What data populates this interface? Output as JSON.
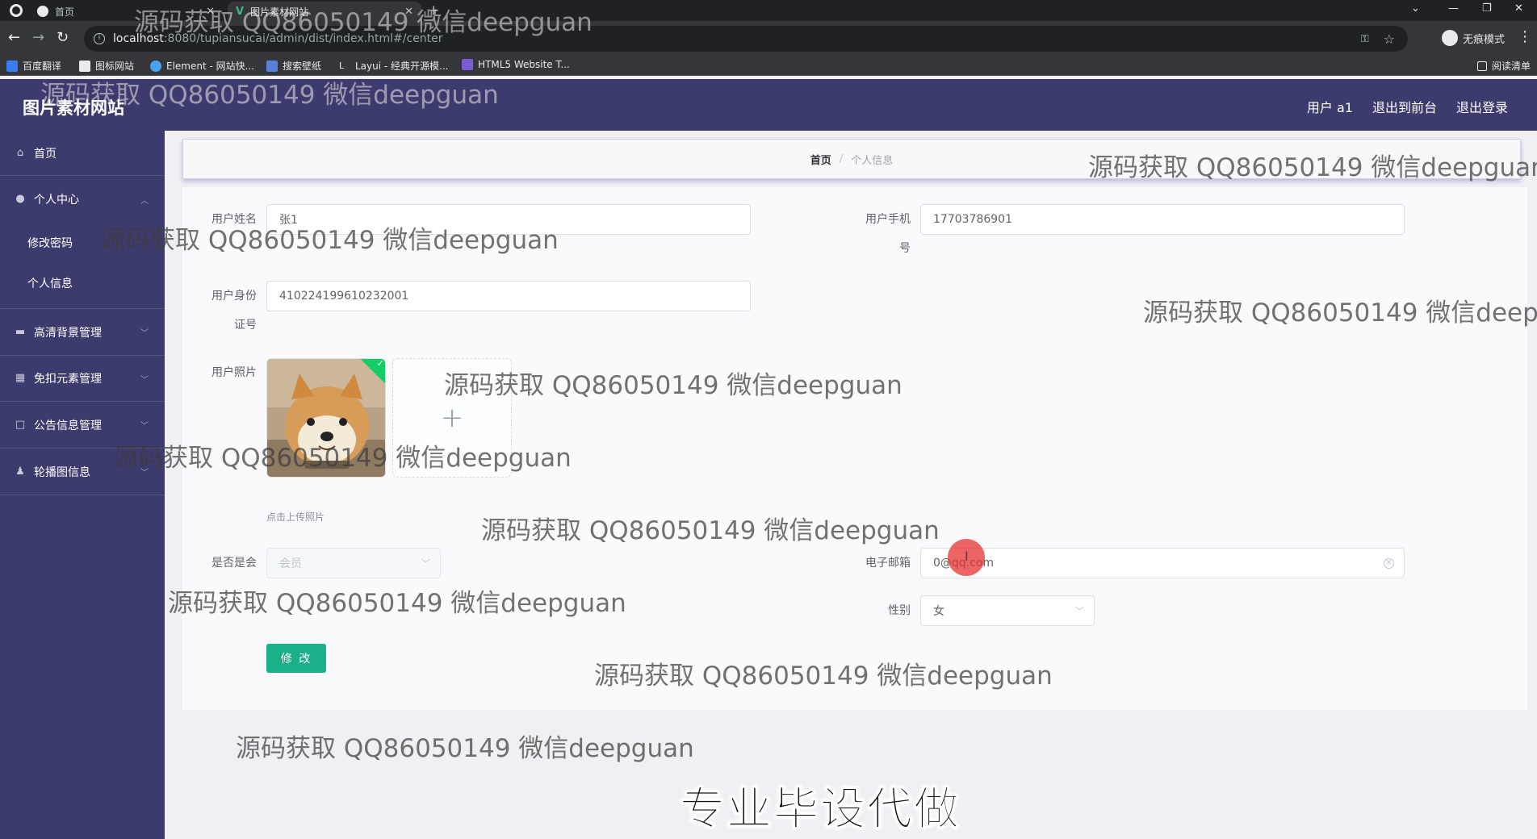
{
  "browser": {
    "tabs": [
      {
        "title": "首页",
        "active": false
      },
      {
        "title": "图片素材网站",
        "active": true
      }
    ],
    "url_host": "localhost",
    "url_path": ":8080/tupiansucai/admin/dist/index.html#/center",
    "incognito_label": "无痕模式",
    "reading_list": "阅读清单",
    "bookmarks": [
      "百度翻译",
      "图标网站",
      "Element - 网站快...",
      "搜索壁纸",
      "Layui - 经典开源模...",
      "HTML5 Website T..."
    ]
  },
  "header": {
    "brand": "图片素材网站",
    "user": "用户 a1",
    "back_to_front": "退出到前台",
    "logout": "退出登录"
  },
  "sidebar": {
    "home": "首页",
    "personal": "个人中心",
    "change_password": "修改密码",
    "personal_info": "个人信息",
    "bg_manage": "高清背景管理",
    "cutout_manage": "免扣元素管理",
    "notice_manage": "公告信息管理",
    "carousel": "轮播图信息"
  },
  "breadcrumb": {
    "home": "首页",
    "sep": "/",
    "current": "个人信息"
  },
  "form": {
    "name_label": "用户姓名",
    "name_value": "张1",
    "phone_label_1": "用户手机",
    "phone_label_2": "号",
    "phone_value": "17703786901",
    "idcard_label_1": "用户身份",
    "idcard_label_2": "证号",
    "idcard_value": "410224199610232001",
    "photo_label": "用户照片",
    "upload_hint": "点击上传照片",
    "upload_plus": "+",
    "member_label": "是否是会",
    "member_value": "会员",
    "email_label": "电子邮箱",
    "email_value": "0@qq.com",
    "gender_label": "性别",
    "gender_value": "女",
    "submit": "修 改"
  },
  "overlay": {
    "watermark": "源码获取 QQ86050149 微信deepguan",
    "watermark_cut": "源码获取 QQ86050149 微信deepgu",
    "caption": "专业毕设代做"
  },
  "colors": {
    "sidebar": "#3c3b6e",
    "accent_button": "#19b08a",
    "success_tick": "#13ce66"
  }
}
